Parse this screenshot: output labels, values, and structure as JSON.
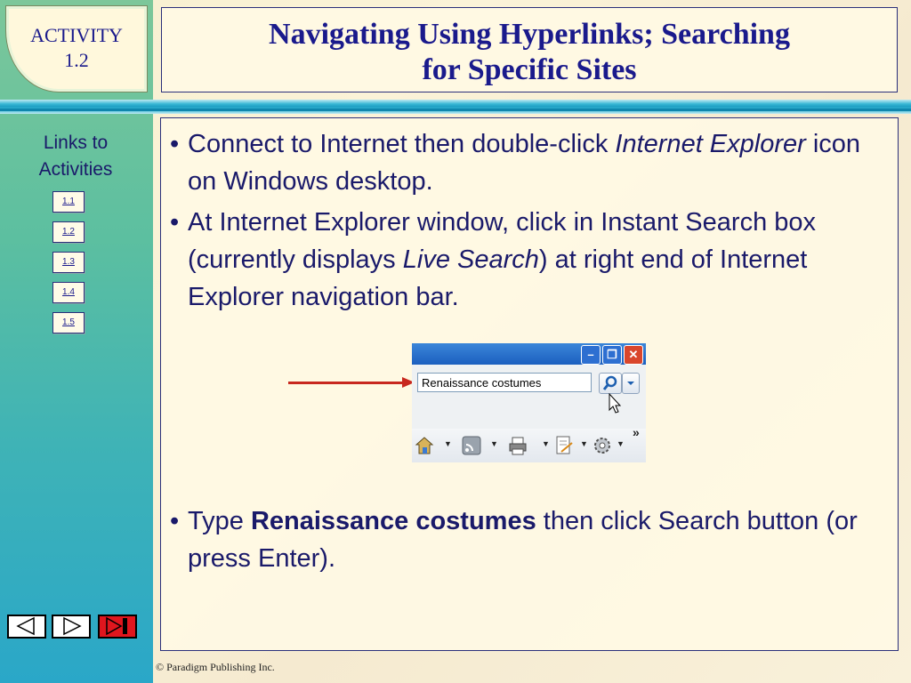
{
  "header": {
    "activity_label": "ACTIVITY",
    "activity_number": "1.2",
    "title_line1": "Navigating Using Hyperlinks; Searching",
    "title_line2": "for Specific Sites"
  },
  "sidebar": {
    "links_title_line1": "Links to",
    "links_title_line2": "Activities",
    "links": [
      "1.1",
      "1.2",
      "1.3",
      "1.4",
      "1.5"
    ]
  },
  "content": {
    "bullet1_a": "Connect to Internet then double-click ",
    "bullet1_italic": "Internet Explorer",
    "bullet1_b": " icon on Windows desktop.",
    "bullet2_a": "At Internet Explorer window, click in Instant Search box (currently displays ",
    "bullet2_italic": "Live Search",
    "bullet2_b": ") at right end of Internet Explorer navigation bar.",
    "bullet3_a": "Type ",
    "bullet3_bold": "Renaissance costumes",
    "bullet3_b": " then click Search button (or press Enter)."
  },
  "screenshot": {
    "search_value": "Renaissance costumes",
    "toolbar_more": "»"
  },
  "footer": {
    "copyright": "© Paradigm Publishing Inc."
  },
  "colors": {
    "title": "#1a1a8c",
    "text": "#1a1a6a",
    "arrow": "#c8281e",
    "last_nav_button": "#e0161e"
  }
}
